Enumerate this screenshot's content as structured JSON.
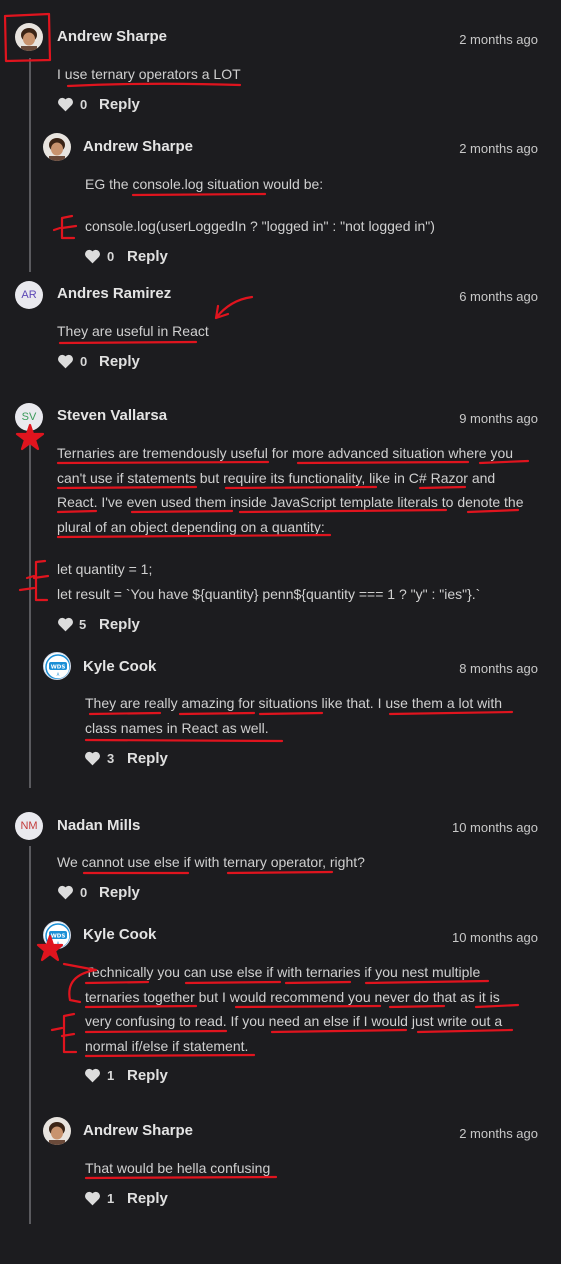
{
  "reply_label": "Reply",
  "colors": {
    "background": "#1c1c1f",
    "annotation": "#e0141e"
  },
  "comments": [
    {
      "id": "c1",
      "author": "Andrew Sharpe",
      "time": "2 months ago",
      "lines": [
        "I use ternary operators a LOT"
      ],
      "likes": "0"
    },
    {
      "id": "c2",
      "author": "Andrew Sharpe",
      "time": "2 months ago",
      "lines": [
        "EG the console.log situation would be:",
        "console.log(userLoggedIn ? \"logged in\" : \"not logged in\")"
      ],
      "likes": "0"
    },
    {
      "id": "c3",
      "author": "Andres Ramirez",
      "initials": "AR",
      "time": "6 months ago",
      "lines": [
        "They are useful in React"
      ],
      "likes": "0"
    },
    {
      "id": "c4",
      "author": "Steven Vallarsa",
      "initials": "SV",
      "time": "9 months ago",
      "lines": [
        "Ternaries are tremendously useful for more advanced situation where you",
        "can't use if statements but require its functionality, like in C# Razor and",
        "React. I've even used them inside JavaScript template literals to denote the",
        "plural of an object depending on a quantity:",
        "let quantity = 1;",
        "let result = `You have ${quantity} penn${quantity === 1 ? \"y\" : \"ies\"}.`"
      ],
      "likes": "5"
    },
    {
      "id": "c5",
      "author": "Kyle Cook",
      "time": "8 months ago",
      "lines": [
        "They are really amazing for situations like that. I use them a lot with",
        "class names in React as well."
      ],
      "likes": "3"
    },
    {
      "id": "c6",
      "author": "Nadan Mills",
      "initials": "NM",
      "time": "10 months ago",
      "lines": [
        "We cannot use else if with ternary operator, right?"
      ],
      "likes": "0"
    },
    {
      "id": "c7",
      "author": "Kyle Cook",
      "time": "10 months ago",
      "lines": [
        "Technically you can use else if with ternaries if you nest multiple",
        "ternaries together but I would recommend you never do that as it is",
        "very confusing to read. If you need an else if I would just write out a",
        "normal if/else if statement."
      ],
      "likes": "1"
    },
    {
      "id": "c8",
      "author": "Andrew Sharpe",
      "time": "2 months ago",
      "lines": [
        "That would be hella confusing"
      ],
      "likes": "1"
    }
  ]
}
